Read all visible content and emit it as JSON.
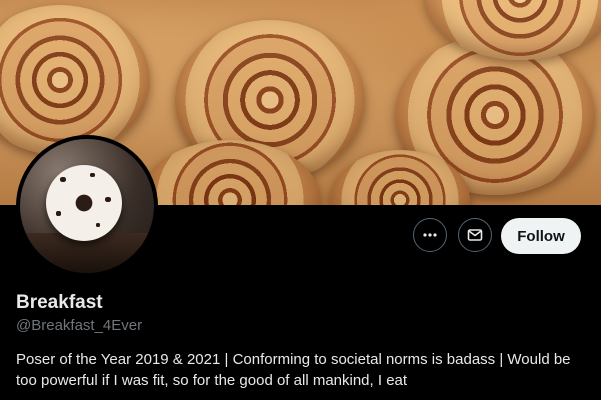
{
  "profile": {
    "display_name": "Breakfast",
    "handle": "@Breakfast_4Ever",
    "bio": "Poser of the Year 2019 & 2021 | Conforming to societal norms is badass | Would be too powerful if I was fit, so for the good of all mankind, I eat"
  },
  "actions": {
    "more_icon": "more-horizontal-icon",
    "message_icon": "envelope-icon",
    "follow_label": "Follow"
  },
  "media": {
    "banner": "cinnamon-rolls-banner",
    "avatar": "frosted-donut-avatar"
  },
  "colors": {
    "background": "#000000",
    "primary_text": "#e7e9ea",
    "secondary_text": "#71767b",
    "button_border": "#536471",
    "follow_button_bg": "#eff3f4",
    "follow_button_text": "#0f1419"
  }
}
